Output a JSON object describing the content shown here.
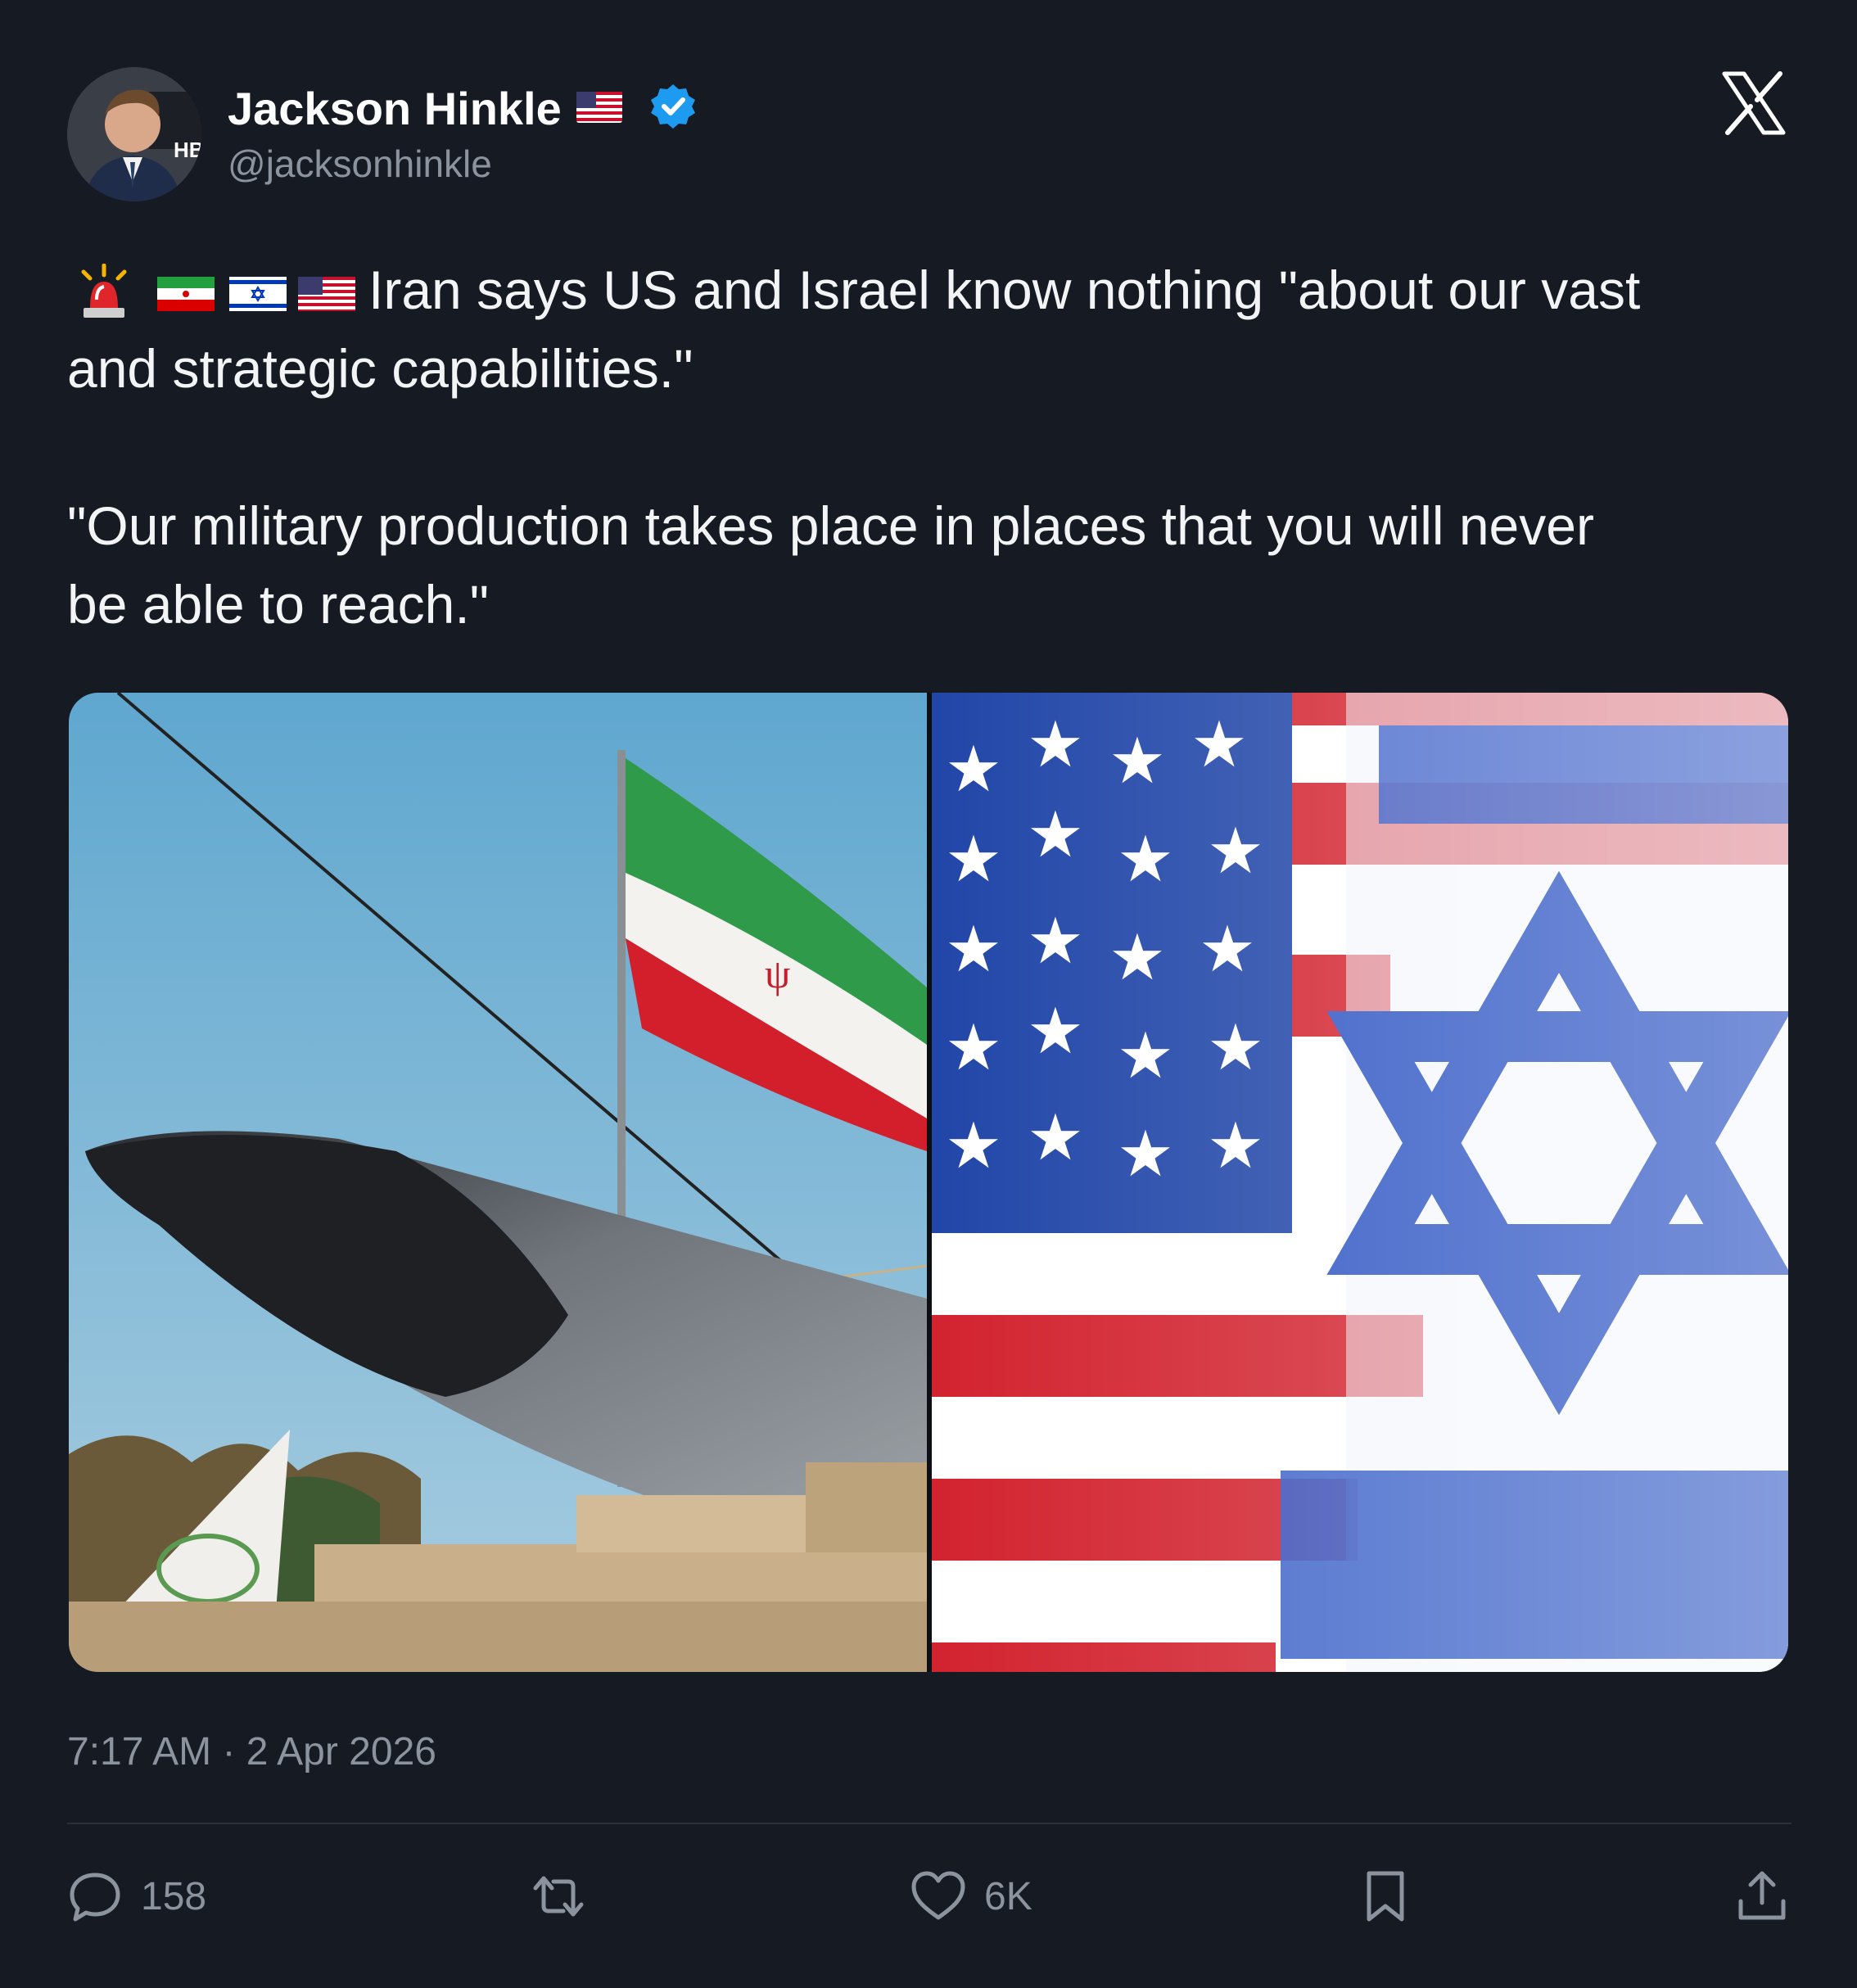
{
  "author": {
    "name": "Jackson Hinkle",
    "handle": "@jacksonhinkle",
    "avatar_badge": "HB",
    "verified": true,
    "name_flag": "us-flag"
  },
  "brand": {
    "logo": "x-logo"
  },
  "tweet": {
    "emoji_prefix": [
      "rotating-light-emoji",
      "iran-flag-emoji",
      "israel-flag-emoji",
      "us-flag-emoji"
    ],
    "line1": "Iran says US and Israel know nothing \"about our vast",
    "line2": "and strategic capabilities.\"",
    "line3": "\"Our military production takes place in places that you will never",
    "line4": "be able to reach.\""
  },
  "media": {
    "images": [
      "missile-with-iran-flag-photo",
      "us-israel-flags-photo"
    ]
  },
  "meta": {
    "timestamp": "7:17 AM · 2 Apr 2026"
  },
  "actions": {
    "replies": "158",
    "likes": "6K"
  },
  "colors": {
    "background": "#161a22",
    "text": "#ffffff",
    "muted": "#8b939e",
    "verified_blue": "#1d9bf0"
  }
}
